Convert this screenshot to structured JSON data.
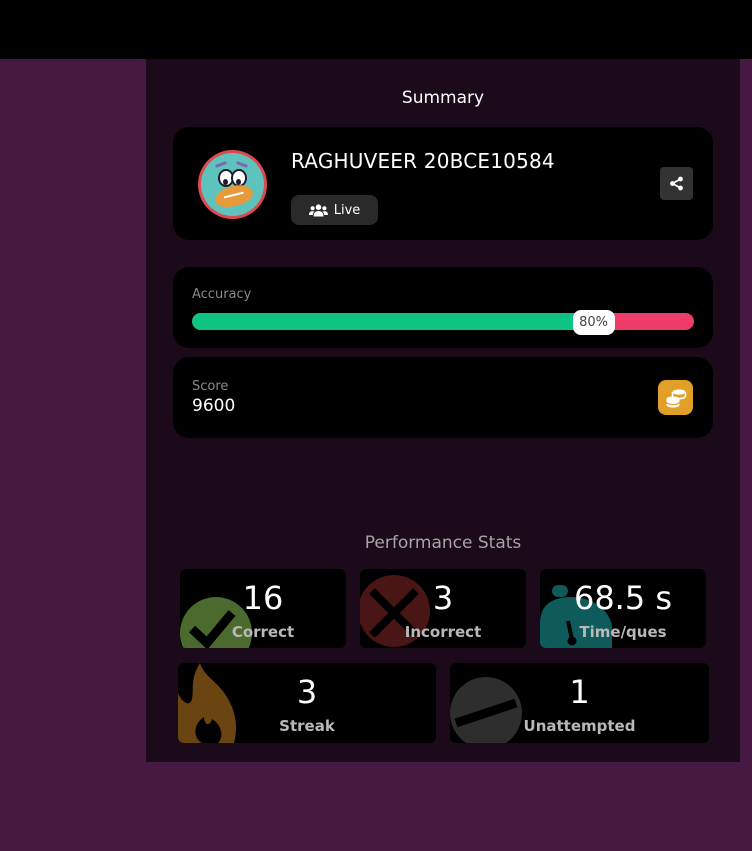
{
  "summary": {
    "title": "Summary"
  },
  "profile": {
    "name": "RAGHUVEER 20BCE10584",
    "mode_label": "Live",
    "avatar_icon": "football-monster-avatar",
    "share_icon": "share-icon"
  },
  "accuracy": {
    "label": "Accuracy",
    "percent_value": 80,
    "percent_text": "80%",
    "fill_color": "#0ec483",
    "track_color": "#ef3c69"
  },
  "score": {
    "label": "Score",
    "value": "9600",
    "icon": "coins-icon"
  },
  "performance": {
    "title": "Performance Stats",
    "stats": {
      "correct": {
        "value": "16",
        "label": "Correct",
        "icon": "checkmark-icon",
        "color": "#4a6a2e"
      },
      "incorrect": {
        "value": "3",
        "label": "Incorrect",
        "icon": "cross-icon",
        "color": "#4a1515"
      },
      "time": {
        "value": "68.5 s",
        "label": "Time/ques",
        "icon": "stopwatch-icon",
        "color": "#0f5a5a"
      },
      "streak": {
        "value": "3",
        "label": "Streak",
        "icon": "flame-icon",
        "color": "#6a4512"
      },
      "unattempted": {
        "value": "1",
        "label": "Unattempted",
        "icon": "dash-icon",
        "color": "#2e2e2e"
      }
    }
  }
}
